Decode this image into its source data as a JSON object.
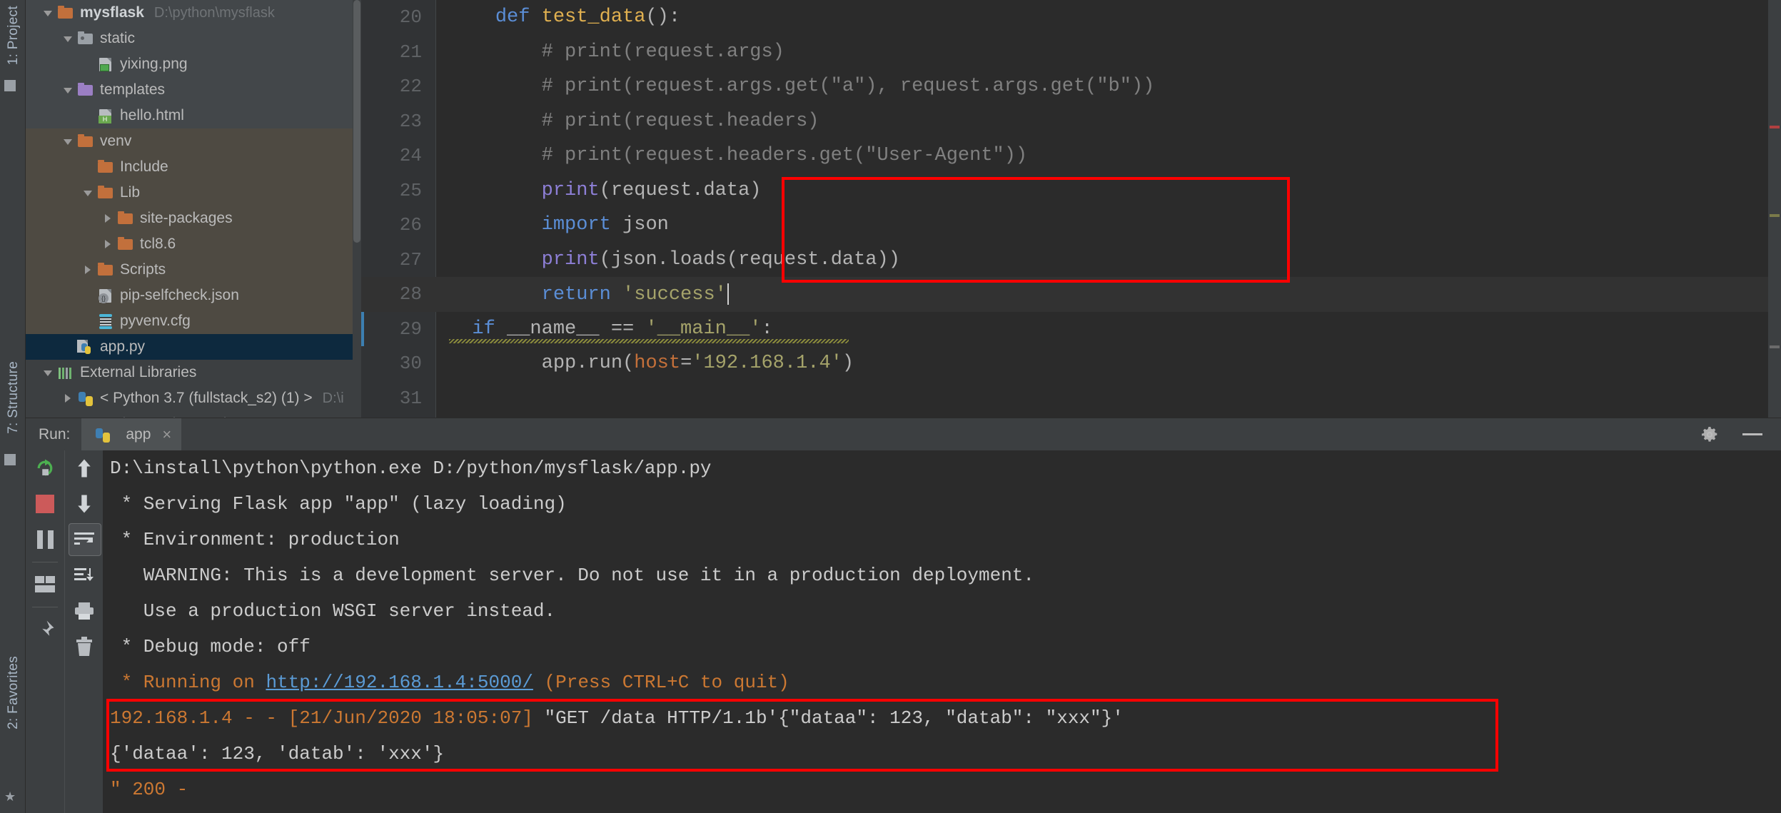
{
  "rails": {
    "project_tab": "1: Project",
    "structure_tab": "7: Structure",
    "favorites_tab": "2: Favorites"
  },
  "project_tree": {
    "items": [
      {
        "label": "mysflask",
        "path": "D:\\python\\mysflask",
        "depth": 0,
        "arrow": "down",
        "icon": "folder-icon",
        "state": "top",
        "bold": true
      },
      {
        "label": "static",
        "path": "",
        "depth": 1,
        "arrow": "down",
        "icon": "folder-gray-icon",
        "state": "top"
      },
      {
        "label": "yixing.png",
        "path": "",
        "depth": 2,
        "arrow": "none",
        "icon": "image-file-icon",
        "state": "top"
      },
      {
        "label": "templates",
        "path": "",
        "depth": 1,
        "arrow": "down",
        "icon": "folder-purple-icon",
        "state": "top"
      },
      {
        "label": "hello.html",
        "path": "",
        "depth": 2,
        "arrow": "none",
        "icon": "html-file-icon",
        "state": "top"
      },
      {
        "label": "venv",
        "path": "",
        "depth": 1,
        "arrow": "down",
        "icon": "folder-icon",
        "state": "venv"
      },
      {
        "label": "Include",
        "path": "",
        "depth": 2,
        "arrow": "none",
        "icon": "folder-icon",
        "state": "venv"
      },
      {
        "label": "Lib",
        "path": "",
        "depth": 2,
        "arrow": "down",
        "icon": "folder-icon",
        "state": "venv"
      },
      {
        "label": "site-packages",
        "path": "",
        "depth": 3,
        "arrow": "right",
        "icon": "folder-icon",
        "state": "venv"
      },
      {
        "label": "tcl8.6",
        "path": "",
        "depth": 3,
        "arrow": "right",
        "icon": "folder-icon",
        "state": "venv"
      },
      {
        "label": "Scripts",
        "path": "",
        "depth": 2,
        "arrow": "right",
        "icon": "folder-icon",
        "state": "venv"
      },
      {
        "label": "pip-selfcheck.json",
        "path": "",
        "depth": 2,
        "arrow": "none",
        "icon": "json-file-icon",
        "state": "venv"
      },
      {
        "label": "pyvenv.cfg",
        "path": "",
        "depth": 2,
        "arrow": "none",
        "icon": "cfg-file-icon",
        "state": "venv"
      },
      {
        "label": "app.py",
        "path": "",
        "depth": 1,
        "arrow": "none",
        "icon": "python-file-icon",
        "state": "selected"
      },
      {
        "label": "External Libraries",
        "path": "",
        "depth": 0,
        "arrow": "down",
        "icon": "library-icon",
        "state": "none"
      },
      {
        "label": "< Python 3.7 (fullstack_s2) (1) >",
        "path": "D:\\i",
        "depth": 1,
        "arrow": "right",
        "icon": "python-icon",
        "state": "none"
      },
      {
        "label": "Scratches and Consoles",
        "path": "",
        "depth": 0,
        "arrow": "none",
        "icon": "scratches-icon",
        "state": "none"
      }
    ]
  },
  "editor": {
    "lines": [
      {
        "num": "20",
        "tokens": [
          {
            "t": "    ",
            "c": "plain"
          },
          {
            "t": "def ",
            "c": "kw"
          },
          {
            "t": "test_data",
            "c": "fn"
          },
          {
            "t": "():",
            "c": "plain"
          }
        ]
      },
      {
        "num": "21",
        "tokens": [
          {
            "t": "        # print(request.args)",
            "c": "cm"
          }
        ]
      },
      {
        "num": "22",
        "tokens": [
          {
            "t": "        # print(request.args.get(\"a\"), request.args.get(\"b\"))",
            "c": "cm"
          }
        ]
      },
      {
        "num": "23",
        "tokens": [
          {
            "t": "        # print(request.headers)",
            "c": "cm"
          }
        ]
      },
      {
        "num": "24",
        "tokens": [
          {
            "t": "        # print(request.headers.get(\"User-Agent\"))",
            "c": "cm"
          }
        ]
      },
      {
        "num": "25",
        "tokens": [
          {
            "t": "        ",
            "c": "plain"
          },
          {
            "t": "print",
            "c": "builtin"
          },
          {
            "t": "(request.data)",
            "c": "plain"
          }
        ]
      },
      {
        "num": "26",
        "tokens": [
          {
            "t": "        ",
            "c": "plain"
          },
          {
            "t": "import ",
            "c": "kw"
          },
          {
            "t": "json",
            "c": "plain"
          }
        ]
      },
      {
        "num": "27",
        "tokens": [
          {
            "t": "        ",
            "c": "plain"
          },
          {
            "t": "print",
            "c": "builtin"
          },
          {
            "t": "(json.loads(request.data))",
            "c": "plain"
          }
        ]
      },
      {
        "num": "28",
        "tokens": [
          {
            "t": "        ",
            "c": "plain"
          },
          {
            "t": "return ",
            "c": "kw"
          },
          {
            "t": "'success'",
            "c": "str"
          }
        ],
        "highlight": true,
        "cursor": true
      },
      {
        "num": "29",
        "tokens": [
          {
            "t": "  ",
            "c": "plain"
          },
          {
            "t": "if ",
            "c": "kw"
          },
          {
            "t": "__name__ == ",
            "c": "plain"
          },
          {
            "t": "'__main__'",
            "c": "str"
          },
          {
            "t": ":",
            "c": "plain"
          }
        ],
        "squiggle": true,
        "marker": true
      },
      {
        "num": "30",
        "tokens": [
          {
            "t": "        app.run(",
            "c": "plain"
          },
          {
            "t": "host",
            "c": "param"
          },
          {
            "t": "=",
            "c": "plain"
          },
          {
            "t": "'192.168.1.4'",
            "c": "str"
          },
          {
            "t": ")",
            "c": "plain"
          }
        ]
      },
      {
        "num": "31",
        "tokens": [
          {
            "t": "",
            "c": "plain"
          }
        ]
      }
    ]
  },
  "run_panel": {
    "run_label": "Run:",
    "tab_name": "app",
    "close_glyph": "×",
    "gear_name": "settings-gear",
    "minimize_name": "minimize",
    "toolbar_left": [
      {
        "name": "rerun-button",
        "glyph": "rerun"
      },
      {
        "name": "stop-button",
        "glyph": "stop"
      },
      {
        "name": "pause-button",
        "glyph": "pause"
      },
      {
        "name": "layout-button",
        "glyph": "layout"
      },
      {
        "name": "pin-button",
        "glyph": "pin"
      }
    ],
    "toolbar_right": [
      {
        "name": "up-arrow-button",
        "glyph": "↑"
      },
      {
        "name": "down-arrow-button",
        "glyph": "↓"
      },
      {
        "name": "soft-wrap-button",
        "glyph": "wrap",
        "active": true
      },
      {
        "name": "scroll-to-end-button",
        "glyph": "scrollend"
      },
      {
        "name": "print-button",
        "glyph": "printer"
      },
      {
        "name": "clear-all-button",
        "glyph": "trash"
      }
    ],
    "console_lines": [
      {
        "segments": [
          {
            "text": "D:\\install\\python\\python.exe D:/python/mysflask/app.py",
            "color": "white"
          }
        ]
      },
      {
        "segments": [
          {
            "text": " * Serving Flask app \"app\" (lazy loading)",
            "color": "white"
          }
        ]
      },
      {
        "segments": [
          {
            "text": " * Environment: production",
            "color": "white"
          }
        ]
      },
      {
        "segments": [
          {
            "text": "   WARNING: This is a development server. Do not use it in a production deployment.",
            "color": "white"
          }
        ]
      },
      {
        "segments": [
          {
            "text": "   Use a production WSGI server instead.",
            "color": "white"
          }
        ]
      },
      {
        "segments": [
          {
            "text": " * Debug mode: off",
            "color": "white"
          }
        ]
      },
      {
        "segments": [
          {
            "text": " * Running on ",
            "color": "orange"
          },
          {
            "text": "http://192.168.1.4:5000/",
            "color": "link"
          },
          {
            "text": " (Press CTRL+C to quit)",
            "color": "orange"
          }
        ]
      },
      {
        "segments": [
          {
            "text": "192.168.1.4 - - [21/Jun/2020 18:05:07] ",
            "color": "orange"
          },
          {
            "text": "\"GET /data HTTP/1.1b'{\"dataa\": 123, \"datab\": \"xxx\"}'",
            "color": "white"
          }
        ]
      },
      {
        "segments": [
          {
            "text": "{'dataa': 123, 'datab': 'xxx'}",
            "color": "white"
          }
        ]
      },
      {
        "segments": [
          {
            "text": "\" 200 -",
            "color": "orange"
          }
        ]
      }
    ]
  },
  "colors": {
    "accent_red": "#ff0000",
    "editor_bg": "#2b2b2b",
    "panel_bg": "#3c3f41",
    "selection_blue": "#0d293e",
    "keyword_blue": "#5b8ed6",
    "string_olive": "#a5a36a",
    "comment_gray": "#808080",
    "console_orange": "#cc7832"
  }
}
